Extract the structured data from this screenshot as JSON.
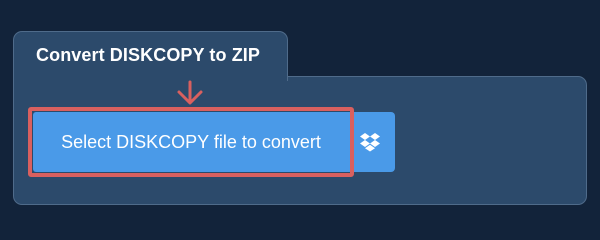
{
  "converter": {
    "tab_title": "Convert DISKCOPY to ZIP",
    "select_button_label": "Select DISKCOPY file to convert",
    "dropbox_icon": "dropbox-icon",
    "annotation": {
      "arrow_icon": "arrow-down-icon",
      "highlight_color": "#d9605f"
    }
  },
  "colors": {
    "page_background": "#12233a",
    "panel_background": "#2c4a6b",
    "button_blue": "#4a9ae8",
    "annotation_red": "#d9605f"
  }
}
